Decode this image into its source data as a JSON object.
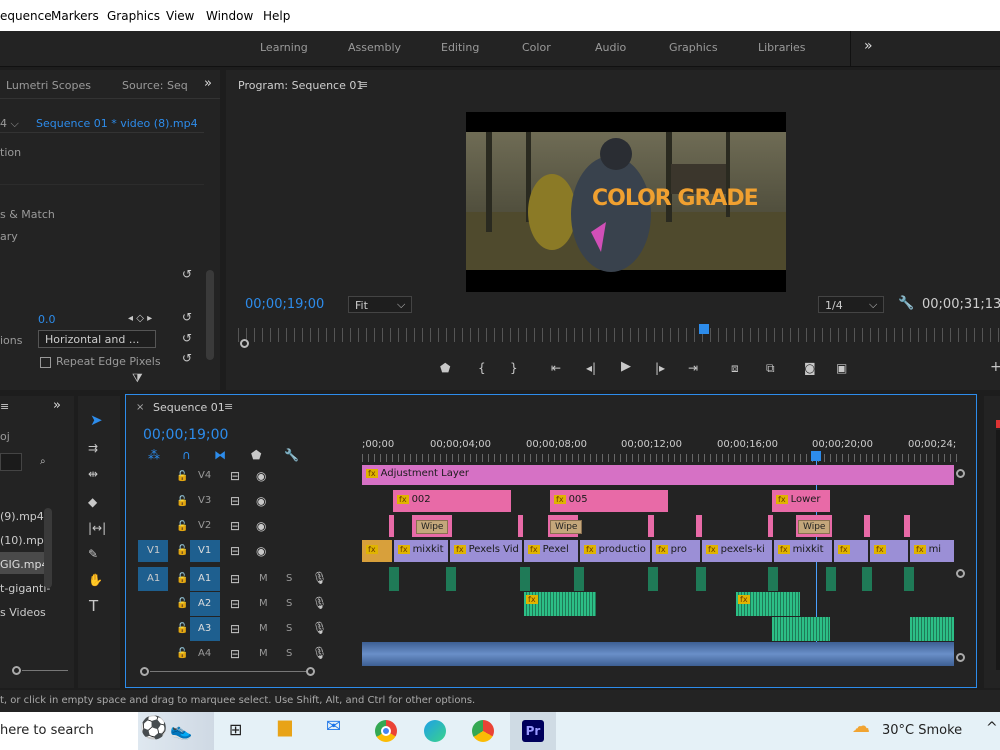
{
  "menu": [
    "equence",
    "Markers",
    "Graphics",
    "View",
    "Window",
    "Help"
  ],
  "workspaces": [
    "Learning",
    "Assembly",
    "Editing",
    "Color",
    "Audio",
    "Graphics",
    "Libraries"
  ],
  "left_panel": {
    "tabs": [
      "Lumetri Scopes",
      "Source: Seq"
    ],
    "clip_select": "Sequence 01 * video (8).mp4",
    "rows": [
      "tion",
      "s & Match",
      "ary"
    ],
    "value": "0.0",
    "dropdown_label": "ions",
    "dropdown_value": "Horizontal and ...",
    "checkbox_label": "Repeat Edge Pixels"
  },
  "program": {
    "title": "Program: Sequence 01",
    "overlay_text": "COLOR GRADE",
    "timecode": "00;00;19;00",
    "fit": "Fit",
    "quality": "1/4",
    "duration": "00;00;31;13"
  },
  "project": {
    "label": "oj",
    "items": [
      "(9).mp4",
      "(10).mp4",
      "GIG.mp4",
      "t-giganti-",
      "s Videos"
    ]
  },
  "timeline": {
    "tab": "Sequence 01",
    "timecode": "00;00;19;00",
    "ruler": [
      ";00;00",
      "00;00;04;00",
      "00;00;08;00",
      "00;00;12;00",
      "00;00;16;00",
      "00;00;20;00",
      "00;00;24;"
    ],
    "video_tracks": [
      "V4",
      "V3",
      "V2",
      "V1"
    ],
    "audio_tracks": [
      "A1",
      "A2",
      "A3",
      "A4"
    ],
    "source_v": "V1",
    "source_a": "A1",
    "adjustment": "Adjustment Layer",
    "v3_clips": [
      "002",
      "005",
      "Lower"
    ],
    "wipe": "Wipe",
    "v1_clips": [
      "mixkit",
      "Pexels Vid",
      "Pexel",
      "productio",
      "pro",
      "pexels-ki",
      "mixkit",
      "",
      "",
      "mi"
    ],
    "m": "M",
    "s": "S"
  },
  "status": "t, or click in empty space and drag to marquee select. Use Shift, Alt, and Ctrl for other options.",
  "taskbar": {
    "search": "here to search",
    "weather": "30°C  Smoke"
  },
  "colors": {
    "accent": "#2d8ceb",
    "pink": "#e86aa7",
    "violet": "#9b8fd6",
    "audio": "#1f7a57",
    "adjust": "#d671c5"
  }
}
